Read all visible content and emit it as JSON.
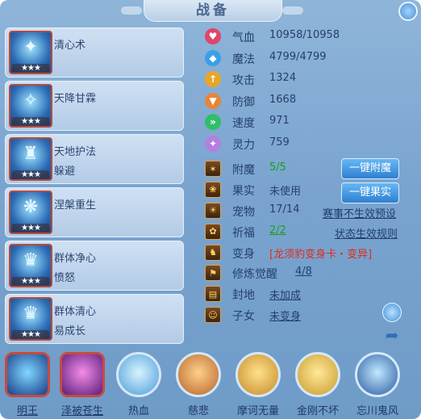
{
  "window": {
    "title": "战备"
  },
  "skills": [
    {
      "name": "清心术",
      "sub": "",
      "stars": "★★★",
      "glyph": "✦"
    },
    {
      "name": "天降甘霖",
      "sub": "",
      "stars": "★★★",
      "glyph": "✧"
    },
    {
      "name": "天地护法",
      "sub": "躲避",
      "stars": "★★★",
      "glyph": "♜"
    },
    {
      "name": "涅槃重生",
      "sub": "",
      "stars": "★★★",
      "glyph": "❋"
    },
    {
      "name": "群体净心",
      "sub": "愤怒",
      "stars": "★★★",
      "glyph": "♛"
    },
    {
      "name": "群体清心",
      "sub": "易成长",
      "stars": "★★★",
      "glyph": "♛"
    }
  ],
  "stats": [
    {
      "label": "气血",
      "value": "10958/10958",
      "color": "#e0456a",
      "icon": "heart-icon",
      "glyph": "♥"
    },
    {
      "label": "魔法",
      "value": "4799/4799",
      "color": "#3aa0e8",
      "icon": "mana-icon",
      "glyph": "◆"
    },
    {
      "label": "攻击",
      "value": "1324",
      "color": "#e8a528",
      "icon": "sword-icon",
      "glyph": "↑"
    },
    {
      "label": "防御",
      "value": "1668",
      "color": "#e8843a",
      "icon": "shield-icon",
      "glyph": "▼"
    },
    {
      "label": "速度",
      "value": "971",
      "color": "#2fbf6a",
      "icon": "speed-icon",
      "glyph": "»"
    },
    {
      "label": "灵力",
      "value": "759",
      "color": "#b47fe0",
      "icon": "spirit-icon",
      "glyph": "✦"
    }
  ],
  "rows": [
    {
      "label": "附魔",
      "value": "5/5",
      "style": "green",
      "icon": "enchant-icon",
      "glyph": "✶"
    },
    {
      "label": "果实",
      "value": "未使用",
      "style": "",
      "icon": "fruit-icon",
      "glyph": "❀"
    },
    {
      "label": "宠物",
      "value": "17/14",
      "style": "",
      "icon": "pet-icon",
      "glyph": "☀"
    },
    {
      "label": "祈福",
      "value": "2/2",
      "style": "green-u",
      "icon": "pray-icon",
      "glyph": "✿"
    },
    {
      "label": "变身",
      "value": "[龙须豹变身卡・变异]",
      "style": "red",
      "icon": "transform-icon",
      "glyph": "♞"
    },
    {
      "label": "修炼觉醒",
      "value": "4/8",
      "style": "u",
      "icon": "cultivate-icon",
      "glyph": "⚑"
    },
    {
      "label": "封地",
      "value": "未加成",
      "style": "u",
      "icon": "fief-icon",
      "glyph": "▤"
    },
    {
      "label": "子女",
      "value": "未变身",
      "style": "u",
      "icon": "child-icon",
      "glyph": "☺"
    }
  ],
  "buttons": {
    "enchant": "一键附魔",
    "fruit": "一键果实"
  },
  "links": {
    "match_preset": "赛事不生效预设",
    "status_rules": "状态生效规则"
  },
  "pets": [
    {
      "name": "明王",
      "underline": true,
      "color1": "#7fd8ff",
      "color2": "#1a3c8a",
      "frame": "sq"
    },
    {
      "name": "泽被苍生",
      "underline": true,
      "color1": "#f48ce8",
      "color2": "#5a1c7a",
      "frame": "sq"
    },
    {
      "name": "热血",
      "underline": false,
      "color1": "#d9f3ff",
      "color2": "#4a9bd8",
      "frame": ""
    },
    {
      "name": "慈悲",
      "underline": false,
      "color1": "#ffd08a",
      "color2": "#b5642a",
      "frame": ""
    },
    {
      "name": "摩诃无量",
      "underline": false,
      "color1": "#ffe08a",
      "color2": "#c58a2a",
      "frame": ""
    },
    {
      "name": "金刚不坏",
      "underline": false,
      "color1": "#ffe99a",
      "color2": "#c89a2a",
      "frame": ""
    },
    {
      "name": "忘川鬼风",
      "underline": false,
      "color1": "#bfe8ff",
      "color2": "#2a5aa0",
      "frame": ""
    }
  ]
}
